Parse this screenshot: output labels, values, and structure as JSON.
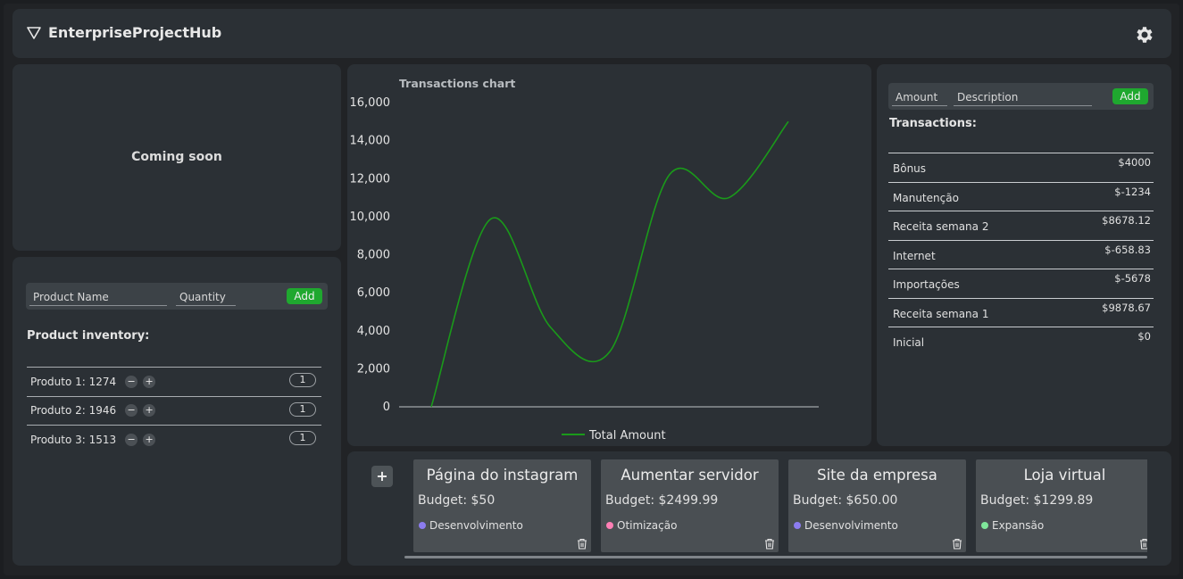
{
  "app": {
    "title": "EnterpriseProjectHub"
  },
  "placeholder": {
    "text": "Coming soon"
  },
  "inventory": {
    "name_placeholder": "Product Name",
    "qty_placeholder": "Quantity",
    "add_label": "Add",
    "title": "Product inventory:",
    "items": [
      {
        "label": "Produto 1: 1274",
        "qty": "1"
      },
      {
        "label": "Produto 2: 1946",
        "qty": "1"
      },
      {
        "label": "Produto 3: 1513",
        "qty": "1"
      }
    ]
  },
  "chart_data": {
    "type": "line",
    "title": "Transactions chart",
    "y_ticks": [
      "0",
      "2,000",
      "4,000",
      "6,000",
      "8,000",
      "10,000",
      "12,000",
      "14,000",
      "16,000"
    ],
    "ylim": [
      0,
      16000
    ],
    "grid": false,
    "legend_position": "bottom",
    "series": [
      {
        "name": "Total Amount",
        "color": "#1a9a1a",
        "values": [
          0,
          9878.67,
          4200.67,
          2900.67,
          12200.67,
          11000.67,
          15000.67
        ]
      }
    ]
  },
  "transactions": {
    "amount_placeholder": "Amount",
    "desc_placeholder": "Description",
    "add_label": "Add",
    "title": "Transactions:",
    "items": [
      {
        "desc": "Bônus",
        "amount": "$4000"
      },
      {
        "desc": "Manutenção",
        "amount": "$-1234"
      },
      {
        "desc": "Receita semana 2",
        "amount": "$8678.12"
      },
      {
        "desc": "Internet",
        "amount": "$-658.83"
      },
      {
        "desc": "Importações",
        "amount": "$-5678"
      },
      {
        "desc": "Receita semana 1",
        "amount": "$9878.67"
      },
      {
        "desc": "Inicial",
        "amount": "$0"
      }
    ]
  },
  "projects": {
    "add_label": "+",
    "items": [
      {
        "title": "Página do instagram",
        "budget": "Budget: $50",
        "tag": "Desenvolvimento",
        "tag_color": "#8c7cf0"
      },
      {
        "title": "Aumentar servidor",
        "budget": "Budget: $2499.99",
        "tag": "Otimização",
        "tag_color": "#ff7fb5"
      },
      {
        "title": "Site da empresa",
        "budget": "Budget: $650.00",
        "tag": "Desenvolvimento",
        "tag_color": "#8c7cf0"
      },
      {
        "title": "Loja virtual",
        "budget": "Budget: $1299.89",
        "tag": "Expansão",
        "tag_color": "#7fe69a"
      }
    ]
  },
  "colors": {
    "accent_green": "#1fa82f",
    "panel": "#2b3035",
    "card": "#4a4f53"
  }
}
